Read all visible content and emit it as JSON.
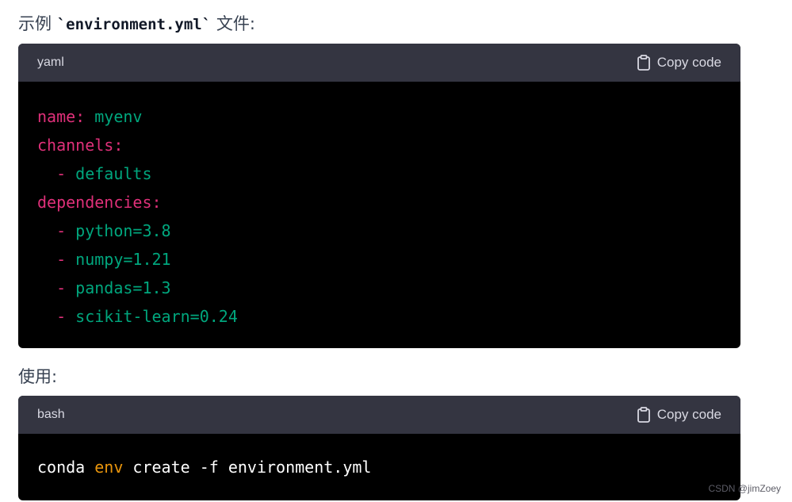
{
  "intro": {
    "prefix": "示例 ",
    "code": "`environment.yml`",
    "suffix": " 文件:"
  },
  "yaml_block": {
    "language": "yaml",
    "copy_label": "Copy code",
    "lines": [
      {
        "key": "name:",
        "value": " myenv"
      },
      {
        "key": "channels:",
        "value": ""
      },
      {
        "dash": "  -",
        "value": " defaults"
      },
      {
        "key": "dependencies:",
        "value": ""
      },
      {
        "dash": "  -",
        "value": " python=3.8"
      },
      {
        "dash": "  -",
        "value": " numpy=1.21"
      },
      {
        "dash": "  -",
        "value": " pandas=1.3"
      },
      {
        "dash": "  -",
        "value": " scikit-learn=0.24"
      }
    ]
  },
  "usage_label": "使用:",
  "bash_block": {
    "language": "bash",
    "copy_label": "Copy code",
    "command": {
      "part1": "conda ",
      "part2": "env",
      "part3": " create -f environment.yml"
    }
  },
  "watermark": "CSDN @jimZoey",
  "colors": {
    "key": "#df3079",
    "value": "#00a67d",
    "builtin": "#e9950c",
    "header_bg": "#343541"
  },
  "icons": {
    "copy": "clipboard-icon"
  }
}
